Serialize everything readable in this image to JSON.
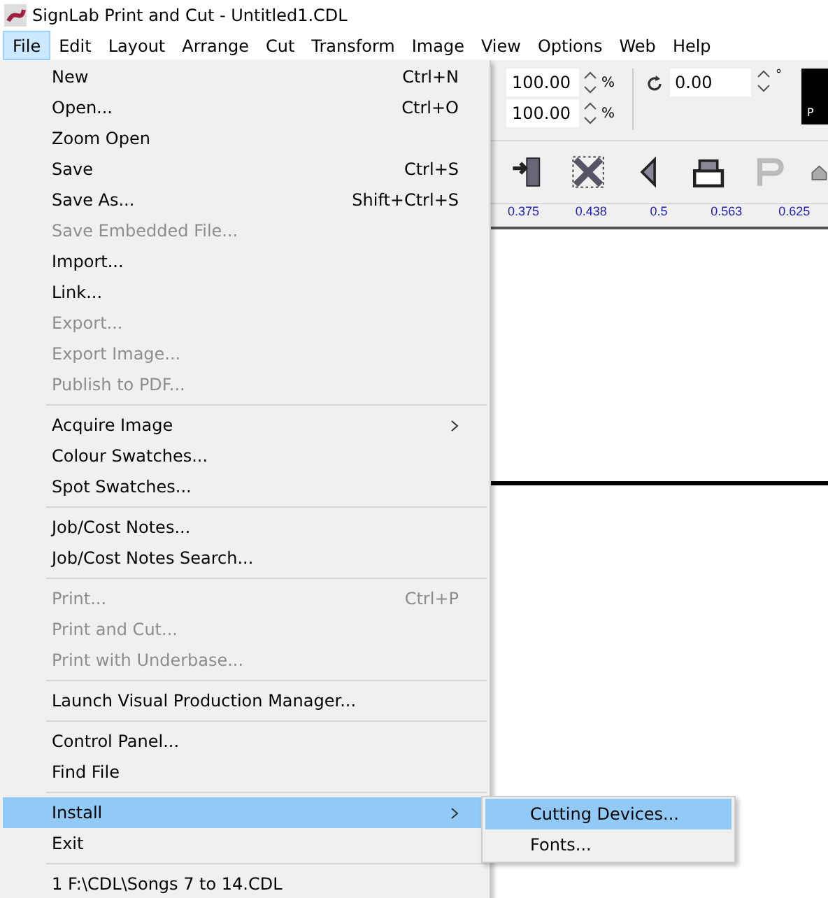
{
  "window": {
    "title": "SignLab Print and Cut - Untitled1.CDL"
  },
  "menubar": [
    {
      "label": "File",
      "selected": true
    },
    {
      "label": "Edit",
      "selected": false
    },
    {
      "label": "Layout",
      "selected": false
    },
    {
      "label": "Arrange",
      "selected": false
    },
    {
      "label": "Cut",
      "selected": false
    },
    {
      "label": "Transform",
      "selected": false
    },
    {
      "label": "Image",
      "selected": false
    },
    {
      "label": "View",
      "selected": false
    },
    {
      "label": "Options",
      "selected": false
    },
    {
      "label": "Web",
      "selected": false
    },
    {
      "label": "Help",
      "selected": false
    }
  ],
  "toolbar": {
    "scale_fields": [
      {
        "value": "100.00",
        "unit": "%"
      },
      {
        "value": "100.00",
        "unit": "%"
      }
    ],
    "rotation": {
      "value": "0.00",
      "unit": "°"
    },
    "swatch_label": "P"
  },
  "ruler": {
    "labels": [
      "0.375",
      "0.438",
      "0.5",
      "0.563",
      "0.625"
    ]
  },
  "file_menu": [
    {
      "kind": "item",
      "label": "New",
      "shortcut": "Ctrl+N",
      "disabled": false,
      "submenu": false,
      "selected": false
    },
    {
      "kind": "item",
      "label": "Open...",
      "shortcut": "Ctrl+O",
      "disabled": false,
      "submenu": false,
      "selected": false
    },
    {
      "kind": "item",
      "label": "Zoom Open",
      "disabled": false,
      "submenu": false,
      "selected": false
    },
    {
      "kind": "item",
      "label": "Save",
      "shortcut": "Ctrl+S",
      "disabled": false,
      "submenu": false,
      "selected": false
    },
    {
      "kind": "item",
      "label": "Save As...",
      "shortcut": "Shift+Ctrl+S",
      "disabled": false,
      "submenu": false,
      "selected": false
    },
    {
      "kind": "item",
      "label": "Save Embedded File...",
      "disabled": true,
      "submenu": false,
      "selected": false
    },
    {
      "kind": "item",
      "label": "Import...",
      "disabled": false,
      "submenu": false,
      "selected": false
    },
    {
      "kind": "item",
      "label": "Link...",
      "disabled": false,
      "submenu": false,
      "selected": false
    },
    {
      "kind": "item",
      "label": "Export...",
      "disabled": true,
      "submenu": false,
      "selected": false
    },
    {
      "kind": "item",
      "label": "Export Image...",
      "disabled": true,
      "submenu": false,
      "selected": false
    },
    {
      "kind": "item",
      "label": "Publish to PDF...",
      "disabled": true,
      "submenu": false,
      "selected": false
    },
    {
      "kind": "separator"
    },
    {
      "kind": "item",
      "label": "Acquire Image",
      "disabled": false,
      "submenu": true,
      "selected": false
    },
    {
      "kind": "item",
      "label": "Colour Swatches...",
      "disabled": false,
      "submenu": false,
      "selected": false
    },
    {
      "kind": "item",
      "label": "Spot Swatches...",
      "disabled": false,
      "submenu": false,
      "selected": false
    },
    {
      "kind": "separator"
    },
    {
      "kind": "item",
      "label": "Job/Cost Notes...",
      "disabled": false,
      "submenu": false,
      "selected": false
    },
    {
      "kind": "item",
      "label": "Job/Cost Notes Search...",
      "disabled": false,
      "submenu": false,
      "selected": false
    },
    {
      "kind": "separator"
    },
    {
      "kind": "item",
      "label": "Print...",
      "shortcut": "Ctrl+P",
      "disabled": true,
      "submenu": false,
      "selected": false
    },
    {
      "kind": "item",
      "label": "Print and Cut...",
      "disabled": true,
      "submenu": false,
      "selected": false
    },
    {
      "kind": "item",
      "label": "Print with Underbase...",
      "disabled": true,
      "submenu": false,
      "selected": false
    },
    {
      "kind": "separator"
    },
    {
      "kind": "item",
      "label": "Launch Visual Production Manager...",
      "disabled": false,
      "submenu": false,
      "selected": false
    },
    {
      "kind": "separator"
    },
    {
      "kind": "item",
      "label": "Control Panel...",
      "disabled": false,
      "submenu": false,
      "selected": false
    },
    {
      "kind": "item",
      "label": "Find File",
      "disabled": false,
      "submenu": false,
      "selected": false
    },
    {
      "kind": "separator"
    },
    {
      "kind": "item",
      "label": "Install",
      "disabled": false,
      "submenu": true,
      "selected": true
    },
    {
      "kind": "item",
      "label": "Exit",
      "disabled": false,
      "submenu": false,
      "selected": false
    },
    {
      "kind": "separator"
    },
    {
      "kind": "item",
      "label": "1 F:\\CDL\\Songs 7 to 14.CDL",
      "disabled": false,
      "submenu": false,
      "selected": false
    }
  ],
  "install_submenu": [
    {
      "label": "Cutting Devices...",
      "selected": true
    },
    {
      "label": "Fonts...",
      "selected": false
    }
  ]
}
